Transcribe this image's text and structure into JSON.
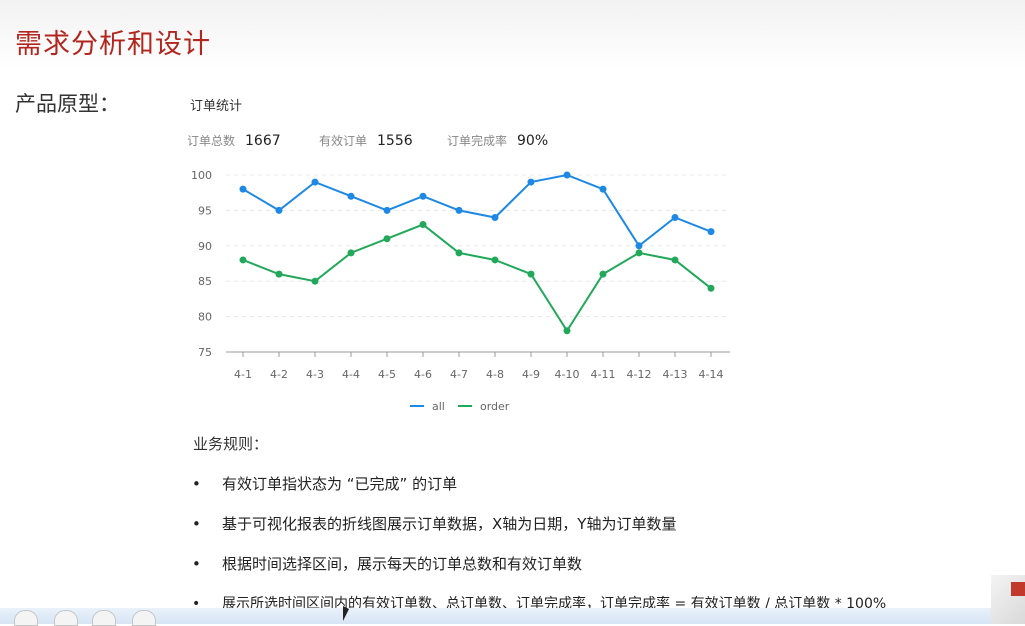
{
  "slide": {
    "title": "需求分析和设计",
    "prototype_label": "产品原型："
  },
  "chart_title": "订单统计",
  "stats": [
    {
      "label": "订单总数",
      "value": "1667"
    },
    {
      "label": "有效订单",
      "value": "1556"
    },
    {
      "label": "订单完成率",
      "value": "90%"
    }
  ],
  "chart_data": {
    "type": "line",
    "categories": [
      "4-1",
      "4-2",
      "4-3",
      "4-4",
      "4-5",
      "4-6",
      "4-7",
      "4-8",
      "4-9",
      "4-10",
      "4-11",
      "4-12",
      "4-13",
      "4-14"
    ],
    "series": [
      {
        "name": "all",
        "color": "#1e88e5",
        "values": [
          98,
          95,
          99,
          97,
          95,
          97,
          95,
          94,
          99,
          100,
          98,
          90,
          94,
          92
        ]
      },
      {
        "name": "order",
        "color": "#22a85a",
        "values": [
          88,
          86,
          85,
          89,
          91,
          93,
          89,
          88,
          86,
          78,
          86,
          89,
          88,
          84
        ]
      }
    ],
    "ylim": [
      75,
      100
    ],
    "yticks": [
      75,
      80,
      85,
      90,
      95,
      100
    ],
    "grid": true,
    "legend": "bottom-center"
  },
  "rules": {
    "title": "业务规则：",
    "bullet": "•",
    "items": [
      "有效订单指状态为 “已完成” 的订单",
      "基于可视化报表的折线图展示订单数据，X轴为日期，Y轴为订单数量",
      "根据时间选择区间，展示每天的订单总数和有效订单数",
      "展示所选时间区间内的有效订单数、总订单数、订单完成率，订单完成率 = 有效订单数 / 总订单数 * 100%"
    ]
  }
}
